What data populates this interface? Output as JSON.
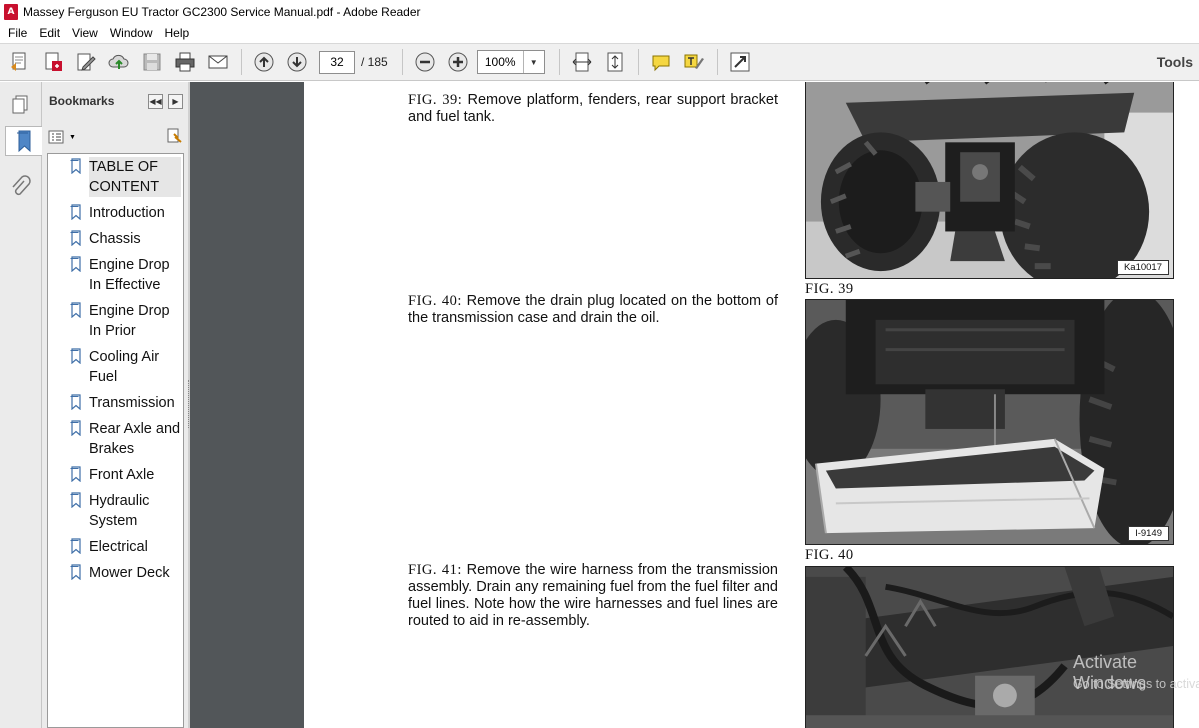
{
  "window": {
    "title": "Massey Ferguson EU Tractor GC2300 Service Manual.pdf - Adobe Reader",
    "app_icon_glyph": "A"
  },
  "menu": [
    "File",
    "Edit",
    "View",
    "Window",
    "Help"
  ],
  "toolbar": {
    "page_current": "32",
    "page_total": "/ 185",
    "zoom": "100%",
    "tools_label": "Tools"
  },
  "bookmarks": {
    "title": "Bookmarks",
    "items": [
      {
        "label": "TABLE OF CONTENT",
        "selected": true
      },
      {
        "label": "Introduction"
      },
      {
        "label": "Chassis"
      },
      {
        "label": "Engine Drop In Effective"
      },
      {
        "label": "Engine Drop In Prior"
      },
      {
        "label": "Cooling Air Fuel"
      },
      {
        "label": "Transmission"
      },
      {
        "label": "Rear Axle and Brakes"
      },
      {
        "label": "Front Axle"
      },
      {
        "label": "Hydraulic System"
      },
      {
        "label": "Electrical"
      },
      {
        "label": "Mower Deck"
      }
    ]
  },
  "document": {
    "fig39": {
      "label": "FIG. 39:",
      "text": "Remove platform, fenders, rear support bracket and fuel tank.",
      "caption": "FIG. 39",
      "photo_tag": "Ka10017"
    },
    "fig40": {
      "label": "FIG. 40:",
      "text": "Remove the drain plug located on the bottom of the transmission case and drain the oil.",
      "caption": "FIG. 40",
      "photo_tag": "I-9149"
    },
    "fig41": {
      "label": "FIG. 41:",
      "text": "Remove the wire harness from the transmission assembly. Drain any remaining fuel from the fuel filter and fuel lines. Note how the wire harnesses and fuel lines are routed to aid in re-assembly."
    }
  },
  "watermark": {
    "line1": "Activate Windows",
    "line2": "Go to Settings to activate Windows."
  }
}
